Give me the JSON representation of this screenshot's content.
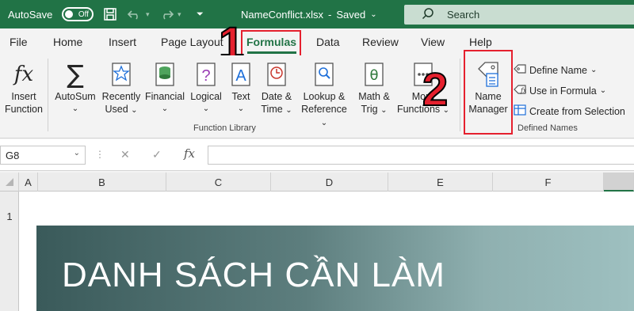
{
  "titlebar": {
    "autosave_label": "AutoSave",
    "autosave_state": "Off",
    "filename": "NameConflict.xlsx",
    "sep": "-",
    "saved": "Saved",
    "search_label": "Search"
  },
  "tabs": [
    "File",
    "Home",
    "Insert",
    "Page Layout",
    "Formulas",
    "Data",
    "Review",
    "View",
    "Help"
  ],
  "annotations": {
    "step1": "1",
    "step2": "2"
  },
  "ribbon": {
    "insert_function": [
      "Insert",
      "Function"
    ],
    "autosum": "AutoSum",
    "recently_used": [
      "Recently",
      "Used"
    ],
    "financial": "Financial",
    "logical": "Logical",
    "text": "Text",
    "date_time": [
      "Date &",
      "Time"
    ],
    "lookup": [
      "Lookup &",
      "Reference"
    ],
    "math_trig": [
      "Math &",
      "Trig"
    ],
    "more_functions": [
      "More",
      "Functions"
    ],
    "function_library_label": "Function Library",
    "name_manager": [
      "Name",
      "Manager"
    ],
    "define_name": "Define Name",
    "use_in_formula": "Use in Formula",
    "create_from_selection": "Create from Selection",
    "defined_names_label": "Defined Names"
  },
  "formula_bar": {
    "namebox": "G8",
    "fx": "fx",
    "cancel": "✕",
    "enter": "✓",
    "value": ""
  },
  "columns": [
    "A",
    "B",
    "C",
    "D",
    "E",
    "F"
  ],
  "rows": [
    "1"
  ],
  "sheet": {
    "banner_text": "DANH SÁCH CẦN LÀM"
  },
  "colors": {
    "excel_green": "#217346",
    "annotation_red": "#e5202e"
  }
}
